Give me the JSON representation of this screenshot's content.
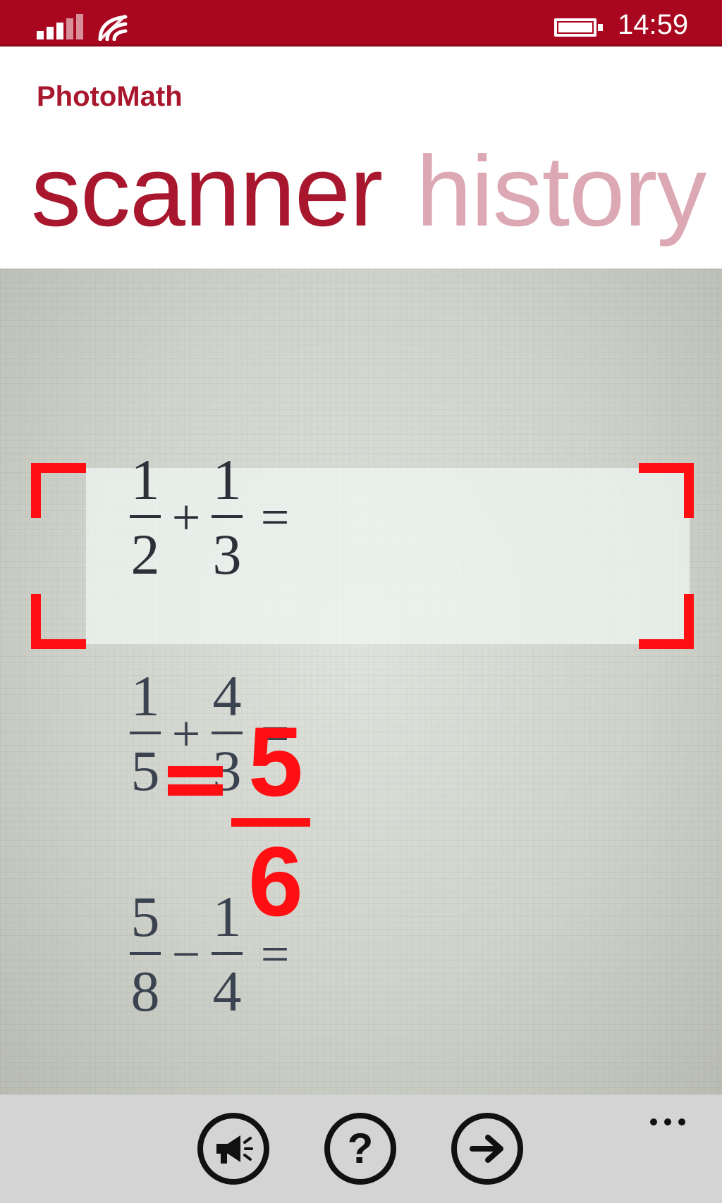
{
  "status_bar": {
    "time": "14:59",
    "icons": [
      "signal-strength-icon",
      "wifi-icon",
      "battery-icon"
    ]
  },
  "header": {
    "app_title": "PhotoMath",
    "tabs": [
      {
        "label": "scanner",
        "active": true
      },
      {
        "label": "history",
        "active": false
      }
    ]
  },
  "viewfinder": {
    "expressions": [
      {
        "a_num": "1",
        "a_den": "2",
        "op": "+",
        "b_num": "1",
        "b_den": "3",
        "eq": "="
      },
      {
        "a_num": "1",
        "a_den": "5",
        "op": "+",
        "b_num": "4",
        "b_den": "3",
        "eq": "="
      },
      {
        "a_num": "5",
        "a_den": "8",
        "op": "−",
        "b_num": "1",
        "b_den": "4",
        "eq": "="
      }
    ],
    "result": {
      "numerator": "5",
      "denominator": "6"
    }
  },
  "app_bar": {
    "buttons": [
      {
        "name": "speak-button",
        "icon": "megaphone-icon"
      },
      {
        "name": "help-button",
        "icon": "question-icon",
        "glyph": "?"
      },
      {
        "name": "next-button",
        "icon": "arrow-right-icon"
      }
    ],
    "more_icon": "ellipsis-icon"
  },
  "colors": {
    "accent": "#a8071f",
    "header_text": "#a8172d",
    "inactive_tab": "#dba8b3",
    "scan_frame": "#ff0f12",
    "app_bar": "#d4d4d4"
  }
}
